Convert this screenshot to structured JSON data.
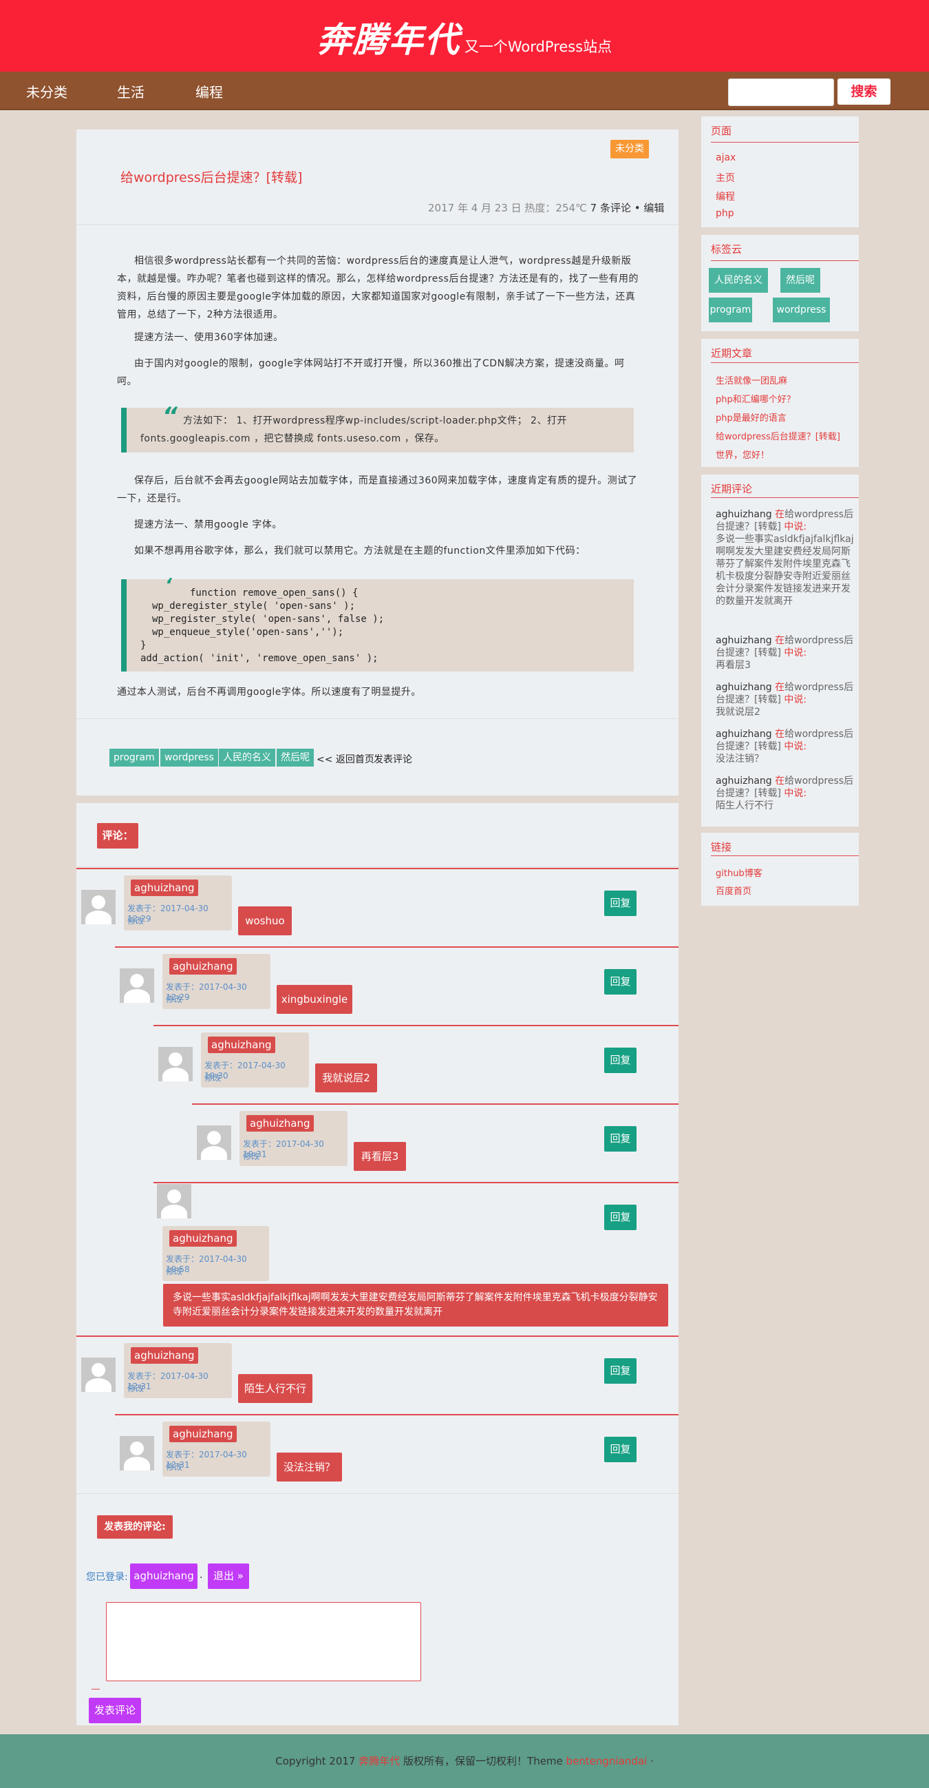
{
  "header": {
    "logo": "奔腾年代",
    "tagline": "又一个WordPress站点"
  },
  "nav": {
    "items": [
      "未分类",
      "生活",
      "编程"
    ],
    "search_button": "搜索",
    "search_placeholder": ""
  },
  "article": {
    "category": "未分类",
    "title": "给wordpress后台提速？[转载]",
    "meta": "2017 年 4 月 23 日 热度：254℃ ",
    "comments_link": "7 条评论",
    "sep": " • ",
    "edit": "编辑",
    "p1": "相信很多wordpress站长都有一个共同的苦恼：wordpress后台的速度真是让人泄气，wordpress越是升级新版本，就越是慢。咋办呢？笔者也碰到这样的情况。那么，怎样给wordpress后台提速？方法还是有的，找了一些有用的资料，后台慢的原因主要是google字体加载的原因，大家都知道国家对google有限制，亲手试了一下一些方法，还真管用，总结了一下，2种方法很适用。",
    "p2": "提速方法一、使用360字体加速。",
    "p3": "由于国内对google的限制，google字体网站打不开或打开慢，所以360推出了CDN解决方案，提速没商量。呵呵。",
    "q1": "方法如下： 1、打开wordpress程序wp-includes/script-loader.php文件； 2、打开fonts.googleapis.com ，把它替换成 fonts.useso.com ，保存。",
    "p4": "保存后，后台就不会再去google网站去加载字体，而是直接通过360网来加载字体，速度肯定有质的提升。测试了一下，还是行。",
    "p5": "提速方法一、禁用google 字体。",
    "p6": "如果不想再用谷歌字体，那么，我们就可以禁用它。方法就是在主题的function文件里添加如下代码：",
    "code": [
      "function remove_open_sans() {",
      "wp_deregister_style( 'open-sans' );",
      "wp_register_style( 'open-sans', false );",
      "wp_enqueue_style('open-sans','');",
      "}",
      "add_action( 'init', 'remove_open_sans' );"
    ],
    "p7": "通过本人测试，后台不再调用google字体。所以速度有了明显提升。",
    "tags": [
      "program",
      "wordpress",
      "人民的名义",
      "然后呢"
    ],
    "back": "<< 返回首页",
    "post_comment": "发表评论"
  },
  "comments": {
    "heading": "评论：",
    "items": [
      {
        "author": "aghuizhang",
        "date": "发表于：2017-04-30 12:29",
        "edit": "修改",
        "text": "woshuo",
        "reply": "回复"
      },
      {
        "author": "aghuizhang",
        "date": "发表于：2017-04-30 12:29",
        "edit": "修改",
        "text": "xingbuxingle",
        "reply": "回复"
      },
      {
        "author": "aghuizhang",
        "date": "发表于：2017-04-30 19:30",
        "edit": "修改",
        "text": "我就说层2",
        "reply": "回复"
      },
      {
        "author": "aghuizhang",
        "date": "发表于：2017-04-30 19:31",
        "edit": "修改",
        "text": "再看层3",
        "reply": "回复"
      },
      {
        "author": "aghuizhang",
        "date": "发表于：2017-04-30 19:58",
        "edit": "修改",
        "text": "多说一些事实asldkfjajfalkjflkaj啊啊发发大里建安费经发局阿斯蒂芬了解案件发附件埃里克森飞机卡极度分裂静安寺附近爱丽丝会计分录案件发链接发进来开发的数量开发就离开",
        "reply": "回复"
      },
      {
        "author": "aghuizhang",
        "date": "发表于：2017-04-30 12:31",
        "edit": "修改",
        "text": "陌生人行不行",
        "reply": "回复"
      },
      {
        "author": "aghuizhang",
        "date": "发表于：2017-04-30 12:31",
        "edit": "修改",
        "text": "没法注销？",
        "reply": "回复"
      }
    ],
    "form_heading": "发表我的评论:",
    "logged_in": "您已登录:",
    "user": "aghuizhang",
    "dot": ".",
    "logout": "退出 »",
    "submit": "发表评论"
  },
  "sidebar": {
    "pages": {
      "title": "页面",
      "links": [
        "ajax",
        "主页",
        "编程",
        "php"
      ]
    },
    "tagcloud": {
      "title": "标签云",
      "tags": [
        "人民的名义",
        "然后呢",
        "program",
        "wordpress"
      ]
    },
    "recent_posts": {
      "title": "近期文章",
      "links": [
        "生活就像一团乱麻",
        "php和汇编哪个好？",
        "php是最好的语言",
        "给wordpress后台提速？[转载]",
        "世界，您好！"
      ]
    },
    "recent_comments": {
      "title": "近期评论",
      "items": [
        {
          "author": "aghuizhang",
          "on": " 在",
          "post": "给wordpress后台提速？[转载]",
          "said": " 中说:",
          "text": "多说一些事实asldkfjajfalkjflkaj啊啊发发大里建安费经发局阿斯蒂芬了解案件发附件埃里克森飞机卡极度分裂静安寺附近爱丽丝会计分录案件发链接发进来开发的数量开发就离开"
        },
        {
          "author": "aghuizhang",
          "on": " 在",
          "post": "给wordpress后台提速？[转载]",
          "said": " 中说:",
          "text": "再看层3"
        },
        {
          "author": "aghuizhang",
          "on": " 在",
          "post": "给wordpress后台提速？[转载]",
          "said": " 中说:",
          "text": "我就说层2"
        },
        {
          "author": "aghuizhang",
          "on": " 在",
          "post": "给wordpress后台提速？[转载]",
          "said": " 中说:",
          "text": "没法注销？"
        },
        {
          "author": "aghuizhang",
          "on": " 在",
          "post": "给wordpress后台提速？[转载]",
          "said": " 中说:",
          "text": "陌生人行不行"
        }
      ]
    },
    "links": {
      "title": "链接",
      "links": [
        "github博客",
        "百度首页"
      ]
    }
  },
  "footer": {
    "prefix": "Copyright 2017 ",
    "site": "奔腾年代",
    "middle": " 版权所有，保留一切权利！Theme ",
    "theme": "bentengniandai",
    "suffix": " ·"
  }
}
